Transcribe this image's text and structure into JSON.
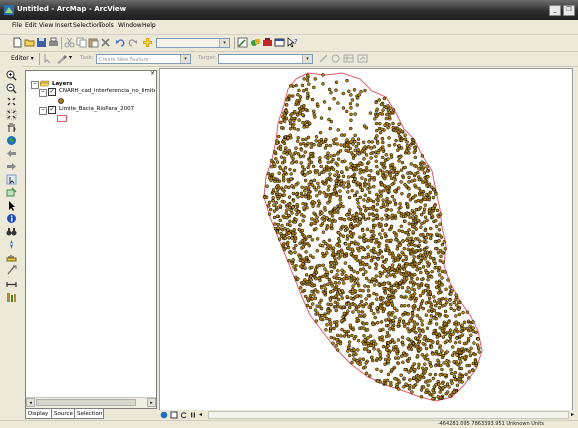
{
  "window": {
    "title": "Untitled - ArcMap - ArcView",
    "minimize": "_",
    "restore": "❐"
  },
  "menu": [
    "File",
    "Edit",
    "View",
    "Insert",
    "Selection",
    "Tools",
    "Window",
    "Help"
  ],
  "editor": {
    "label": "Editor ▾",
    "task_label": "Task:",
    "task_value": "Create New Feature",
    "target_label": "Target:",
    "target_value": ""
  },
  "toc": {
    "root": "Layers",
    "layers": [
      {
        "name": "CNARH_cad_interferencia_no_limite_se",
        "checked": true
      },
      {
        "name": "Limite_Bacia_RioPara_2007",
        "checked": true
      }
    ],
    "expand_symbol": "−"
  },
  "tabs": [
    "Display",
    "Source",
    "Selection"
  ],
  "status": {
    "coordinates": "-464281.095  7863393.951 Unknown Units"
  },
  "colors": {
    "point_fill": "#B8860B",
    "point_stroke": "#000000",
    "boundary": "#E05A6A",
    "desktop": "#ECE9D8"
  },
  "icons": {
    "standard": [
      "new-icon",
      "open-icon",
      "save-icon",
      "print-icon",
      "cut-icon",
      "copy-icon",
      "paste-icon",
      "delete-icon",
      "undo-icon",
      "redo-icon",
      "add-data-icon"
    ],
    "tools": [
      "zoom-in-icon",
      "zoom-out-icon",
      "fixed-zoom-in-icon",
      "fixed-zoom-out-icon",
      "pan-icon",
      "full-extent-icon",
      "back-icon",
      "forward-icon",
      "select-features-icon",
      "select-elements-icon",
      "identify-icon",
      "find-icon",
      "go-to-xy-icon",
      "measure-icon",
      "hyperlink-icon",
      "swipe-icon",
      "time-slider-icon"
    ]
  }
}
